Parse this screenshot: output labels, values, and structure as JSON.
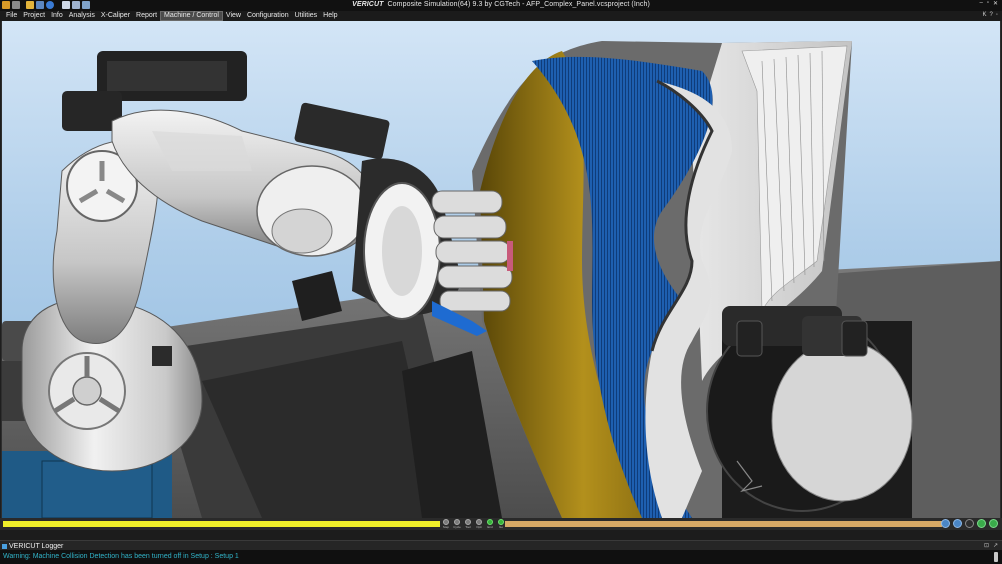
{
  "window": {
    "brand": "VERICUT",
    "title": "Composite Simulation(64)  9.3 by CGTech - AFP_Complex_Panel.vcsproject (Inch)",
    "controls": [
      "–",
      "▫",
      "✕"
    ]
  },
  "quick_access_icons": [
    "app-icon",
    "machine-icon",
    "open-icon",
    "save-icon",
    "info-icon",
    "layout-icon",
    "window-icon",
    "view-icon"
  ],
  "menu": {
    "items": [
      "File",
      "Project",
      "Info",
      "Analysis",
      "X-Caliper",
      "Report",
      "Machine / Control",
      "View",
      "Configuration",
      "Utilities",
      "Help"
    ],
    "active_index": 6,
    "right_controls": [
      "K",
      "?",
      "◦"
    ]
  },
  "colors": {
    "sky_top": "#d3e5f6",
    "sky_bottom": "#8fb6da",
    "ply_blue": "#1e5fb0",
    "ply_gold": "#b08a1a",
    "progress_sim": "#f0ef2a",
    "progress_remaining": "#d6a966",
    "logger_text": "#31b3c8"
  },
  "playback": {
    "progress": 0.47,
    "mid_controls": [
      {
        "icon": "step-icon",
        "label": "Step"
      },
      {
        "icon": "cycle-icon",
        "label": "Cycle"
      },
      {
        "icon": "tool-icon",
        "label": "Tool"
      },
      {
        "icon": "opti-icon",
        "label": "Opti"
      },
      {
        "icon": "end-icon",
        "label": "End"
      },
      {
        "icon": "go-icon",
        "label": "Go"
      }
    ],
    "right_controls": [
      "reset-model-icon",
      "rewind-icon",
      "pause-icon",
      "step-forward-icon",
      "play-icon"
    ]
  },
  "logger": {
    "tab_title": "VERICUT Logger",
    "header_controls": [
      "⊡",
      "↗"
    ],
    "message": "Warning: Machine Collision Detection has been turned off in Setup : Setup 1"
  }
}
